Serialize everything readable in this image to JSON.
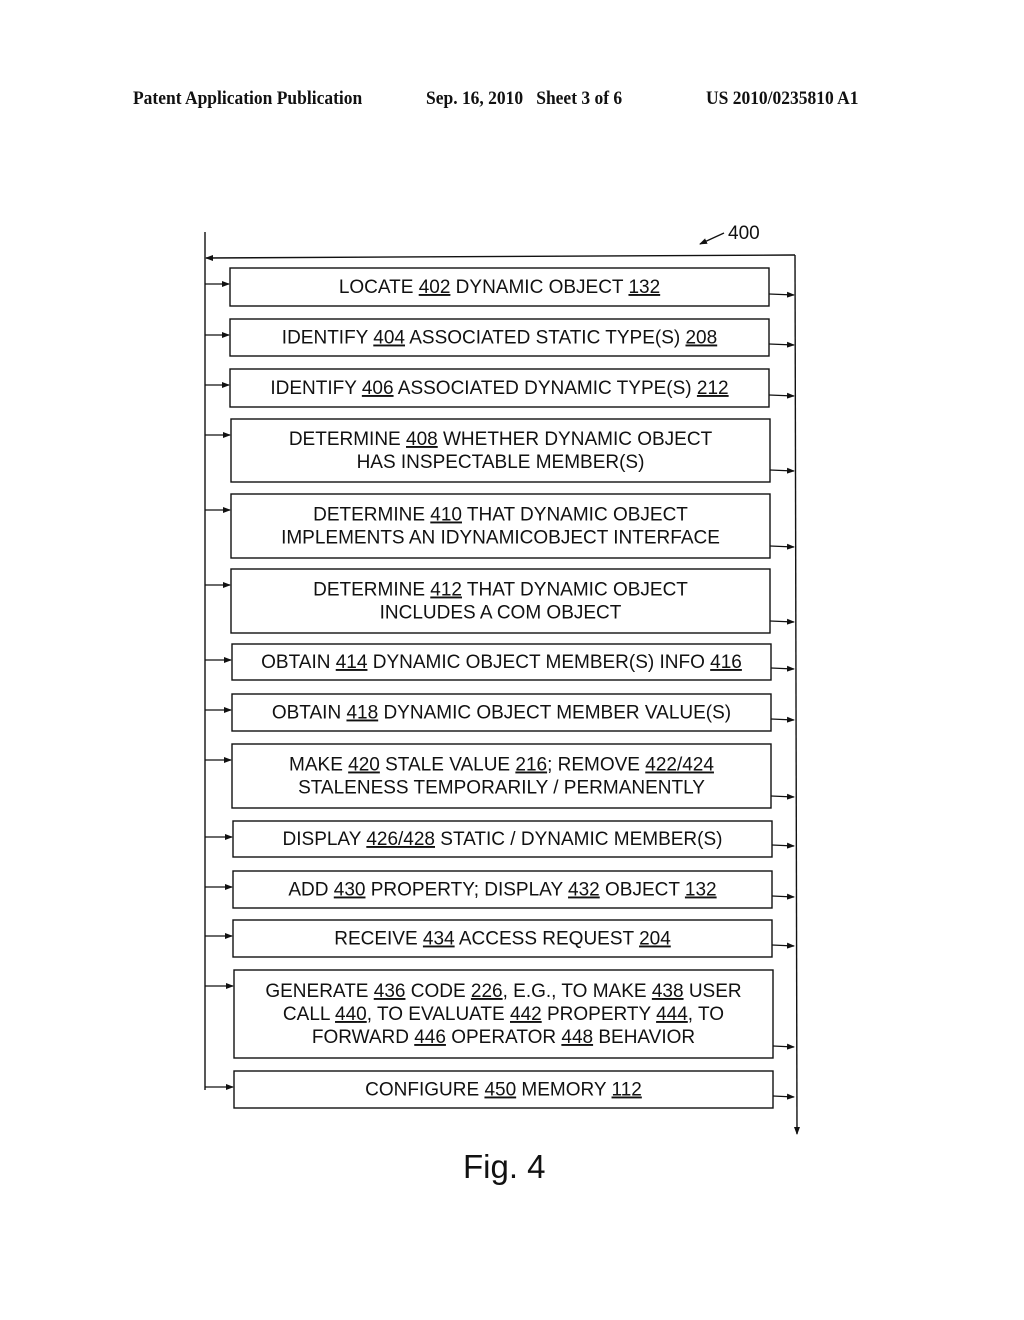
{
  "header": {
    "left": "Patent Application Publication",
    "middle": "Sep. 16, 2010   Sheet 3 of 6",
    "right": "US 2010/0235810 A1"
  },
  "diagram": {
    "reference_label": "400",
    "figure_label": "Fig. 4",
    "steps": [
      {
        "id": "402",
        "lines": [
          [
            {
              "t": "LOCATE "
            },
            {
              "t": "402",
              "u": true
            },
            {
              "t": " DYNAMIC OBJECT "
            },
            {
              "t": "132",
              "u": true
            }
          ]
        ]
      },
      {
        "id": "404",
        "lines": [
          [
            {
              "t": "IDENTIFY "
            },
            {
              "t": "404",
              "u": true
            },
            {
              "t": " ASSOCIATED STATIC TYPE(S) "
            },
            {
              "t": "208",
              "u": true
            }
          ]
        ]
      },
      {
        "id": "406",
        "lines": [
          [
            {
              "t": "IDENTIFY "
            },
            {
              "t": "406",
              "u": true
            },
            {
              "t": " ASSOCIATED DYNAMIC TYPE(S) "
            },
            {
              "t": "212",
              "u": true
            }
          ]
        ]
      },
      {
        "id": "408",
        "lines": [
          [
            {
              "t": "DETERMINE "
            },
            {
              "t": "408",
              "u": true
            },
            {
              "t": " WHETHER DYNAMIC OBJECT"
            }
          ],
          [
            {
              "t": "HAS INSPECTABLE MEMBER(S)"
            }
          ]
        ]
      },
      {
        "id": "410",
        "lines": [
          [
            {
              "t": "DETERMINE "
            },
            {
              "t": "410",
              "u": true
            },
            {
              "t": " THAT DYNAMIC OBJECT"
            }
          ],
          [
            {
              "t": "IMPLEMENTS AN IDYNAMICOBJECT INTERFACE"
            }
          ]
        ]
      },
      {
        "id": "412",
        "lines": [
          [
            {
              "t": "DETERMINE "
            },
            {
              "t": "412",
              "u": true
            },
            {
              "t": " THAT DYNAMIC OBJECT"
            }
          ],
          [
            {
              "t": "INCLUDES A COM OBJECT"
            }
          ]
        ]
      },
      {
        "id": "414",
        "lines": [
          [
            {
              "t": "OBTAIN "
            },
            {
              "t": "414",
              "u": true
            },
            {
              "t": " DYNAMIC OBJECT MEMBER(S) INFO "
            },
            {
              "t": "416",
              "u": true
            }
          ]
        ]
      },
      {
        "id": "418",
        "lines": [
          [
            {
              "t": "OBTAIN "
            },
            {
              "t": "418",
              "u": true
            },
            {
              "t": " DYNAMIC OBJECT MEMBER VALUE(S)"
            }
          ]
        ]
      },
      {
        "id": "420",
        "lines": [
          [
            {
              "t": "MAKE "
            },
            {
              "t": "420",
              "u": true
            },
            {
              "t": " STALE VALUE "
            },
            {
              "t": "216",
              "u": true
            },
            {
              "t": "; REMOVE "
            },
            {
              "t": "422/424",
              "u": true
            }
          ],
          [
            {
              "t": "STALENESS TEMPORARILY / PERMANENTLY"
            }
          ]
        ]
      },
      {
        "id": "426",
        "lines": [
          [
            {
              "t": "DISPLAY "
            },
            {
              "t": "426/428",
              "u": true
            },
            {
              "t": " STATIC / DYNAMIC MEMBER(S)"
            }
          ]
        ]
      },
      {
        "id": "430",
        "lines": [
          [
            {
              "t": "ADD "
            },
            {
              "t": "430",
              "u": true
            },
            {
              "t": " PROPERTY; DISPLAY "
            },
            {
              "t": "432",
              "u": true
            },
            {
              "t": " OBJECT "
            },
            {
              "t": "132",
              "u": true
            }
          ]
        ]
      },
      {
        "id": "434",
        "lines": [
          [
            {
              "t": "RECEIVE "
            },
            {
              "t": "434",
              "u": true
            },
            {
              "t": " ACCESS REQUEST "
            },
            {
              "t": "204",
              "u": true
            }
          ]
        ]
      },
      {
        "id": "436",
        "lines": [
          [
            {
              "t": "GENERATE "
            },
            {
              "t": "436",
              "u": true
            },
            {
              "t": " CODE "
            },
            {
              "t": "226",
              "u": true
            },
            {
              "t": ", E.G., TO MAKE "
            },
            {
              "t": "438",
              "u": true
            },
            {
              "t": " USER"
            }
          ],
          [
            {
              "t": "CALL "
            },
            {
              "t": "440",
              "u": true
            },
            {
              "t": ", TO EVALUATE "
            },
            {
              "t": "442",
              "u": true
            },
            {
              "t": " PROPERTY "
            },
            {
              "t": "444",
              "u": true
            },
            {
              "t": ", TO"
            }
          ],
          [
            {
              "t": "FORWARD "
            },
            {
              "t": "446",
              "u": true
            },
            {
              "t": " OPERATOR "
            },
            {
              "t": "448",
              "u": true
            },
            {
              "t": " BEHAVIOR"
            }
          ]
        ]
      },
      {
        "id": "450",
        "lines": [
          [
            {
              "t": "CONFIGURE "
            },
            {
              "t": "450",
              "u": true
            },
            {
              "t": " MEMORY "
            },
            {
              "t": "112",
              "u": true
            }
          ]
        ]
      }
    ]
  }
}
